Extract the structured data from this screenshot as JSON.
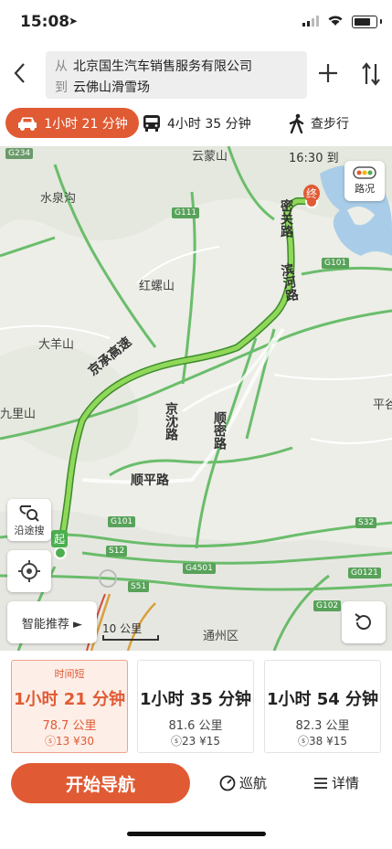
{
  "status": {
    "time": "15:08"
  },
  "route": {
    "from_prefix": "从",
    "from": "北京国生汽车销售服务有限公司",
    "to_prefix": "到",
    "to": "云佛山滑雪场"
  },
  "tabs": [
    {
      "label": "1小时 21 分钟",
      "icon": "car-icon"
    },
    {
      "label": "4小时 35 分钟",
      "icon": "bus-icon"
    },
    {
      "label": "查步行",
      "icon": "walk-icon"
    }
  ],
  "map": {
    "eta": "16:30 到",
    "traffic_label": "路况",
    "along_label": "沿途搜",
    "recommend_label": "智能推荐 ►",
    "scale_label": "10 公里",
    "start_marker": "起",
    "end_marker": "终",
    "places": [
      "云蒙山",
      "水泉沟",
      "红螺山",
      "大羊山",
      "九里山",
      "平谷",
      "通州区"
    ],
    "roads": [
      "密关路",
      "滨河路",
      "京承高速",
      "京沈路",
      "顺密路",
      "顺平路"
    ],
    "shields": [
      "G234",
      "G111",
      "G101",
      "S32",
      "G4501",
      "G0121",
      "G102",
      "S12",
      "S51",
      "G101"
    ]
  },
  "options": [
    {
      "tag": "时间短",
      "duration": "1小时 21 分钟",
      "distance": "78.7 公里",
      "fees": "ⓢ13  ¥30"
    },
    {
      "tag": "",
      "duration": "1小时 35 分钟",
      "distance": "81.6 公里",
      "fees": "ⓢ23  ¥15"
    },
    {
      "tag": "",
      "duration": "1小时 54 分钟",
      "distance": "82.3 公里",
      "fees": "ⓢ38  ¥15"
    }
  ],
  "actions": {
    "start": "开始导航",
    "cruise": "巡航",
    "detail": "详情"
  },
  "colors": {
    "accent": "#e05a33",
    "route": "#7ac94a",
    "road": "#5db85e"
  }
}
